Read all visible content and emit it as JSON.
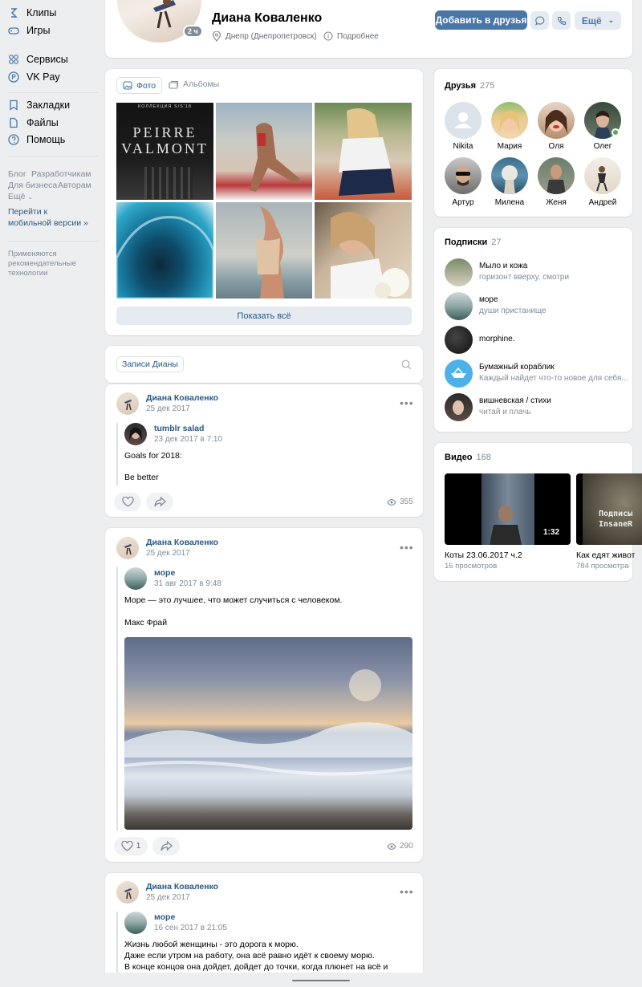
{
  "left_nav": {
    "items": [
      {
        "label": "Клипы",
        "icon": "clips-icon"
      },
      {
        "label": "Игры",
        "icon": "gamepad-icon"
      },
      {
        "label": "Сервисы",
        "icon": "services-icon"
      },
      {
        "label": "VK Pay",
        "icon": "vkpay-icon"
      },
      {
        "label": "Закладки",
        "icon": "bookmark-icon"
      },
      {
        "label": "Файлы",
        "icon": "file-icon"
      },
      {
        "label": "Помощь",
        "icon": "help-icon"
      }
    ],
    "footer_links": [
      "Блог",
      "Разработчикам",
      "Для бизнеса",
      "Авторам",
      "Ещё"
    ],
    "mobile_link": "Перейти к мобильной версии »",
    "reco_note": "Применяются рекомендательные технологии"
  },
  "profile": {
    "name": "Диана Коваленко",
    "online_badge": "2 ч",
    "city": "Днепр (Днепропетровск)",
    "more_info": "Подробнее",
    "add_friend": "Добавить в друзья",
    "more": "Ещё"
  },
  "photos": {
    "tab_photos": "Фото",
    "tab_albums": "Альбомы",
    "show_all": "Показать всё",
    "cover_text_1": "КОЛЛЕКЦИЯ S/S'18",
    "cover_text_2": "PEIRRE",
    "cover_text_3": "VALMONT"
  },
  "wall": {
    "tab": "Записи Дианы"
  },
  "posts": [
    {
      "author": "Диана Коваленко",
      "date": "25 дек 2017",
      "repost_author": "tumblr salad",
      "repost_date": "23 дек 2017 в 7:10",
      "text_1": "Goals for 2018:",
      "text_2": "Be better",
      "likes": "",
      "views": "355"
    },
    {
      "author": "Диана Коваленко",
      "date": "25 дек 2017",
      "repost_author": "море",
      "repost_date": "31 авг 2017 в 9:48",
      "text_1": "Море — это лучшее, что может случиться с человеком.",
      "text_2": "Макс Фрай",
      "likes": "1",
      "views": "290"
    },
    {
      "author": "Диана Коваленко",
      "date": "25 дек 2017",
      "repost_author": "море",
      "repost_date": "16 сен 2017 в 21:05",
      "text_1": "Жизнь любой женщины - это дорога к морю.",
      "text_2": "Даже если утром на работу, она всё равно идёт к своему морю.",
      "text_3": "В конце концов она дойдет, дойдет до точки, когда плюнет на всё и"
    }
  ],
  "friends": {
    "title": "Друзья",
    "count": "275",
    "list": [
      "Nikita",
      "Мария",
      "Оля",
      "Олег",
      "Артур",
      "Милена",
      "Женя",
      "Андрей"
    ]
  },
  "subscriptions": {
    "title": "Подписки",
    "count": "27",
    "list": [
      {
        "name": "Мыло и кожа",
        "desc": "горизонт вверху, смотри"
      },
      {
        "name": "море",
        "desc": "души пристанище"
      },
      {
        "name": "morphine.",
        "desc": ""
      },
      {
        "name": "Бумажный кораблик",
        "desc": "Каждый найдет что-то новое для себя..."
      },
      {
        "name": "вишневская / стихи",
        "desc": "читай и плачь"
      }
    ]
  },
  "videos": {
    "title": "Видео",
    "count": "168",
    "list": [
      {
        "title": "Коты 23.06.2017 ч.2",
        "views": "16 просмотров",
        "duration": "1:32"
      },
      {
        "title": "Как едят живот",
        "views": "784 просмотра",
        "overlay": "Подписы InsaneR"
      }
    ]
  },
  "colors": {
    "accent": "#4a76a8",
    "link": "#2a5885",
    "background": "#edeef0"
  }
}
